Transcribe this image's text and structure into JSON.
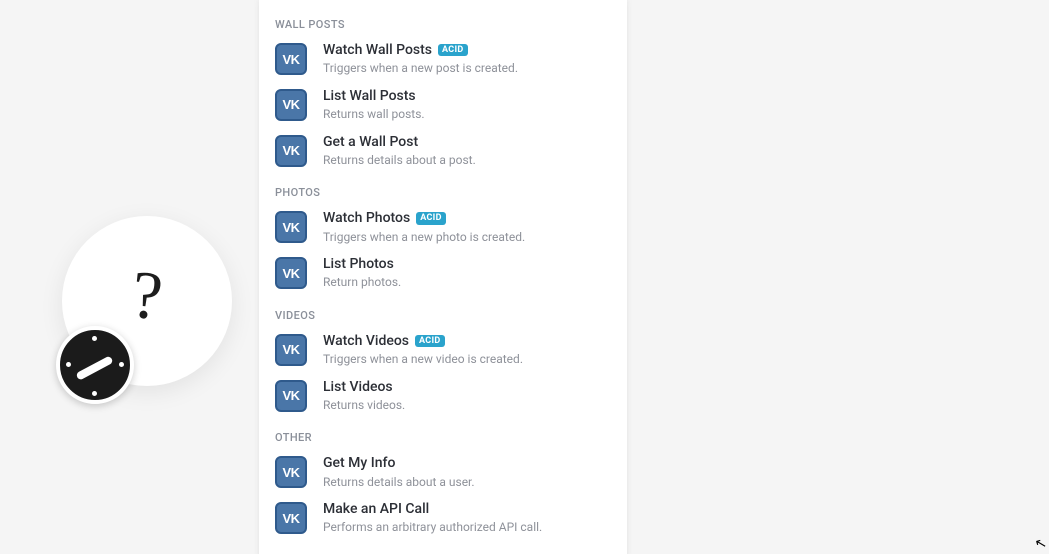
{
  "sections": [
    {
      "id": "wall-posts",
      "header": "WALL POSTS",
      "items": [
        {
          "title": "Watch Wall Posts",
          "desc": "Triggers when a new post is created.",
          "badge": "ACID"
        },
        {
          "title": "List Wall Posts",
          "desc": "Returns wall posts."
        },
        {
          "title": "Get a Wall Post",
          "desc": "Returns details about a post."
        }
      ]
    },
    {
      "id": "photos",
      "header": "PHOTOS",
      "items": [
        {
          "title": "Watch Photos",
          "desc": "Triggers when a new photo is created.",
          "badge": "ACID"
        },
        {
          "title": "List Photos",
          "desc": "Return photos."
        }
      ]
    },
    {
      "id": "videos",
      "header": "VIDEOS",
      "items": [
        {
          "title": "Watch Videos",
          "desc": "Triggers when a new video is created.",
          "badge": "ACID"
        },
        {
          "title": "List Videos",
          "desc": "Returns videos."
        }
      ]
    },
    {
      "id": "other",
      "header": "OTHER",
      "items": [
        {
          "title": "Get My Info",
          "desc": "Returns details about a user."
        },
        {
          "title": "Make an API Call",
          "desc": "Performs an arbitrary authorized API call."
        }
      ]
    }
  ],
  "vk_label": "VK",
  "help_q": "?"
}
